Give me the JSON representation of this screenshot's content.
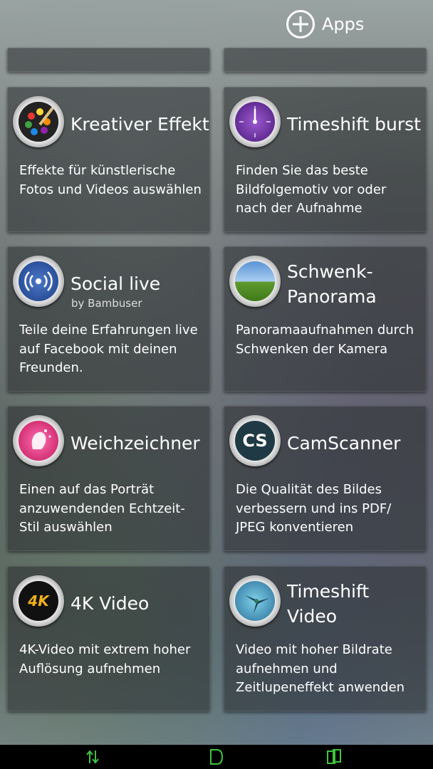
{
  "header": {
    "apps_label": "Apps"
  },
  "cards": [
    {
      "title": "Kreativer Effekt",
      "desc": "Effekte für künstlerische Fotos und Videos auswählen"
    },
    {
      "title": "Timeshift burst",
      "desc": "Finden Sie das beste Bildfolgemotiv vor oder nach der Aufnahme"
    },
    {
      "title": "Social live",
      "subtitle": "by Bambuser",
      "desc": "Teile deine Erfahrungen live auf Facebook mit deinen Freunden."
    },
    {
      "title": "Schwenk-Panorama",
      "desc": "Panoramaaufnahmen durch Schwenken der Kamera"
    },
    {
      "title": "Weichzeichner",
      "desc": "Einen auf das Porträt anzuwendenden Echtzeit-Stil auswählen"
    },
    {
      "title": "CamScanner",
      "icon_text": "CS",
      "desc": "Die Qualität des Bildes verbessern und ins PDF/ JPEG konventieren"
    },
    {
      "title": "4K Video",
      "icon_text": "4K",
      "desc": "4K-Video mit extrem hoher Auflösung aufnehmen"
    },
    {
      "title": "Timeshift Video",
      "desc": "Video mit hoher Bildrate aufnehmen und Zeitlupeneffekt anwenden"
    }
  ],
  "icons": [
    "palette-icon",
    "clock-burst-icon",
    "broadcast-icon",
    "panorama-icon",
    "portrait-blur-icon",
    "camscanner-icon",
    "4k-icon",
    "hummingbird-icon"
  ],
  "colors": {
    "nav_green": "#3fc43f",
    "navbar_bg": "#000000"
  }
}
